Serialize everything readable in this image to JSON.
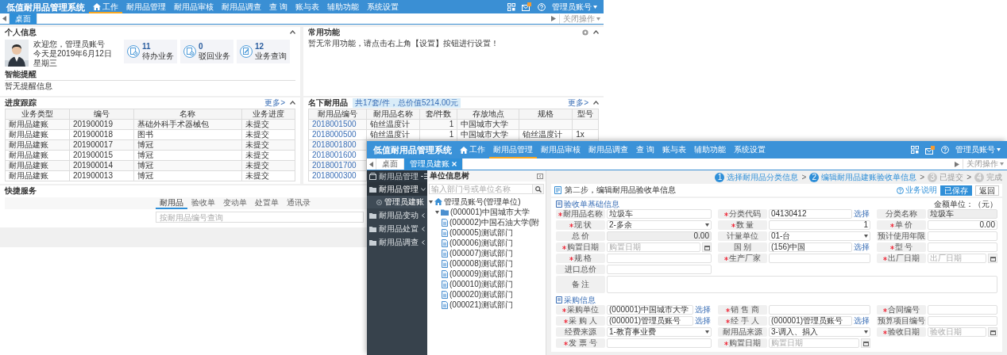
{
  "back_window": {
    "app_title": "低值耐用品管理系统",
    "nav": [
      {
        "label": "工作",
        "selected": true
      },
      {
        "label": "耐用品管理",
        "selected": false
      },
      {
        "label": "耐用品审核",
        "selected": false
      },
      {
        "label": "耐用品调查",
        "selected": false
      },
      {
        "label": "查 询",
        "selected": false
      },
      {
        "label": "账与表",
        "selected": false
      },
      {
        "label": "辅助功能",
        "selected": false
      },
      {
        "label": "系统设置",
        "selected": false
      }
    ],
    "user_menu": "管理员账号",
    "tabs": [
      {
        "label": "桌面",
        "selected": true,
        "closable": false
      }
    ],
    "close_menu": "关闭操作",
    "personal": {
      "title": "个人信息",
      "greeting": "欢迎您，管理员账号",
      "date": "今天是2019年6月12日",
      "weekday": "星期三",
      "stats": [
        {
          "count": "11",
          "label": "待办业务"
        },
        {
          "count": "0",
          "label": "驳回业务"
        },
        {
          "count": "12",
          "label": "业务查询"
        }
      ],
      "reminder_title": "智能提醒",
      "reminder_text": "暂无提醒信息"
    },
    "favorites": {
      "title": "常用功能",
      "text": "暂无常用功能，请点击右上角【设置】按钮进行设置！"
    },
    "progress": {
      "title": "进度跟踪",
      "more": "更多>",
      "columns": [
        "业务类型",
        "编号",
        "名称",
        "业务进度"
      ],
      "rows": [
        [
          "耐用品建账",
          "201900019",
          "基础外科手术器械包",
          "未提交"
        ],
        [
          "耐用品建账",
          "201900018",
          "图书",
          "未提交"
        ],
        [
          "耐用品建账",
          "201900017",
          "博冠",
          "未提交"
        ],
        [
          "耐用品建账",
          "201900015",
          "博冠",
          "未提交"
        ],
        [
          "耐用品建账",
          "201900014",
          "博冠",
          "未提交"
        ],
        [
          "耐用品建账",
          "201900013",
          "博冠",
          "未提交"
        ]
      ]
    },
    "owned": {
      "title": "名下耐用品",
      "summary": "共17套/件，总价值5214.00元",
      "more": "更多>",
      "columns": [
        "耐用品编号",
        "耐用品名称",
        "套/件数",
        "存放地点",
        "规格",
        "型号"
      ],
      "rows": [
        [
          "2018001500",
          "铂丝温度计",
          "1",
          "中国城市大学",
          "",
          ""
        ],
        [
          "2018000500",
          "铂丝温度计",
          "1",
          "中国城市大学",
          "铂丝温度计",
          "1x"
        ],
        [
          "2018001800"
        ],
        [
          "2018001600"
        ],
        [
          "2018001700"
        ],
        [
          "2018000300"
        ]
      ]
    },
    "quick": {
      "title": "快捷服务",
      "tabs": [
        {
          "label": "耐用品",
          "selected": true
        },
        {
          "label": "验收单",
          "selected": false
        },
        {
          "label": "变动单",
          "selected": false
        },
        {
          "label": "处置单",
          "selected": false
        },
        {
          "label": "通讯录",
          "selected": false
        }
      ],
      "search": {
        "placeholder": "按耐用品编号查询"
      }
    }
  },
  "front_window": {
    "app_title": "低值耐用品管理系统",
    "nav": [
      {
        "label": "工作",
        "selected": false
      },
      {
        "label": "耐用品管理",
        "selected": true
      },
      {
        "label": "耐用品审核",
        "selected": false
      },
      {
        "label": "耐用品调查",
        "selected": false
      },
      {
        "label": "查 询",
        "selected": false
      },
      {
        "label": "账与表",
        "selected": false
      },
      {
        "label": "辅助功能",
        "selected": false
      },
      {
        "label": "系统设置",
        "selected": false
      }
    ],
    "user_menu": "管理员账号",
    "tabs": [
      {
        "label": "桌面",
        "selected": false,
        "closable": false
      },
      {
        "label": "管理员建账",
        "selected": true,
        "closable": true
      }
    ],
    "close_menu": "关闭操作",
    "sidebar": {
      "title": "耐用品管理",
      "items": [
        {
          "label": "耐用品管理",
          "expanded": true,
          "children": [
            {
              "label": "管理员建账",
              "selected": true
            }
          ]
        },
        {
          "label": "耐用品变动",
          "expanded": false
        },
        {
          "label": "耐用品处置",
          "expanded": false
        },
        {
          "label": "耐用品调查",
          "expanded": false
        }
      ]
    },
    "unit_tree": {
      "title": "单位信息树",
      "search": {
        "placeholder": "输入部门号或单位名称"
      },
      "nodes": [
        {
          "label": "管理员账号(管理单位)",
          "kind": "root",
          "expanded": true,
          "children": [
            {
              "label": "(000001)中国城市大学",
              "kind": "folder",
              "expanded": true,
              "children": [
                {
                  "label": "(000002)中国石油大学(附",
                  "kind": "leaf"
                },
                {
                  "label": "(000005)测试部门",
                  "kind": "leaf"
                },
                {
                  "label": "(000006)测试部门",
                  "kind": "leaf"
                },
                {
                  "label": "(000007)测试部门",
                  "kind": "leaf"
                },
                {
                  "label": "(000008)测试部门",
                  "kind": "leaf"
                },
                {
                  "label": "(000009)测试部门",
                  "kind": "leaf"
                },
                {
                  "label": "(000010)测试部门",
                  "kind": "leaf"
                },
                {
                  "label": "(000020)测试部门",
                  "kind": "leaf"
                },
                {
                  "label": "(000021)测试部门",
                  "kind": "leaf"
                }
              ]
            }
          ]
        }
      ]
    },
    "steps": [
      {
        "number": "1",
        "label": "选择耐用品分类信息",
        "active": true
      },
      {
        "number": "2",
        "label": "编辑耐用品建账验收单信息",
        "active": true
      },
      {
        "number": "3",
        "label": "已提交",
        "active": false
      },
      {
        "number": "4",
        "label": "完成",
        "active": false
      }
    ],
    "step_separators": [
      ">",
      ">",
      ">"
    ],
    "page_title": "第二步，编辑耐用品验收单信息",
    "actions": [
      {
        "label": "业务说明",
        "kind": "help"
      },
      {
        "label": "已保存",
        "kind": "primary"
      },
      {
        "label": "返回",
        "kind": "default"
      }
    ],
    "sections": [
      {
        "title": "验收单基础信息",
        "note": "金额单位：（元）",
        "rows": [
          [
            {
              "label": "耐用品名称",
              "required": true,
              "kind": "text",
              "value": "垃圾车"
            },
            {
              "label": "分类代码",
              "required": true,
              "kind": "text",
              "value": "04130412",
              "action": "选择"
            },
            {
              "label": "分类名称",
              "required": false,
              "kind": "readonly",
              "value": "垃圾车"
            }
          ],
          [
            {
              "label": "现 状",
              "required": true,
              "kind": "select",
              "value": "2-多余"
            },
            {
              "label": "数 量",
              "required": true,
              "kind": "number",
              "value": "1"
            },
            {
              "label": "单 价",
              "required": true,
              "kind": "number",
              "value": "0.00"
            }
          ],
          [
            {
              "label": "总 价",
              "required": false,
              "kind": "readonly_number",
              "value": "0.00"
            },
            {
              "label": "计量单位",
              "required": false,
              "kind": "select",
              "value": "01-台"
            },
            {
              "label": "预计使用年限",
              "required": false,
              "kind": "text"
            }
          ],
          [
            {
              "label": "购置日期",
              "required": true,
              "kind": "date",
              "placeholder": "购置日期"
            },
            {
              "label": "国 别",
              "required": false,
              "kind": "text",
              "value": "(156)中国",
              "action": "选择"
            },
            {
              "label": "型 号",
              "required": true,
              "kind": "text"
            }
          ],
          [
            {
              "label": "规 格",
              "required": true,
              "kind": "text"
            },
            {
              "label": "生产厂家",
              "required": true,
              "kind": "text"
            },
            {
              "label": "出厂日期",
              "required": true,
              "kind": "date",
              "placeholder": "出厂日期"
            }
          ],
          [
            {
              "label": "进口总价",
              "required": false,
              "kind": "text"
            }
          ],
          [
            {
              "label": "备 注",
              "required": false,
              "kind": "textarea"
            }
          ]
        ]
      },
      {
        "title": "采购信息",
        "rows": [
          [
            {
              "label": "采购单位",
              "required": true,
              "kind": "text",
              "value": "(000001)中国城市大学",
              "action": "选择"
            },
            {
              "label": "销 售 商",
              "required": true,
              "kind": "text"
            },
            {
              "label": "合同编号",
              "required": true,
              "kind": "text"
            }
          ],
          [
            {
              "label": "采 购 人",
              "required": true,
              "kind": "text",
              "value": "(000001)管理员账号",
              "action": "选择"
            },
            {
              "label": "经 手 人",
              "required": true,
              "kind": "text",
              "value": "(000001)管理员账号",
              "action": "选择"
            },
            {
              "label": "预算项目编号",
              "required": false,
              "kind": "text"
            }
          ],
          [
            {
              "label": "经费来源",
              "required": false,
              "kind": "select",
              "value": "1-教育事业费"
            },
            {
              "label": "耐用品来源",
              "required": false,
              "kind": "select",
              "value": "3-调入、捐入"
            },
            {
              "label": "验收日期",
              "required": true,
              "kind": "date",
              "placeholder": "验收日期"
            }
          ],
          [
            {
              "label": "发 票 号",
              "required": true,
              "kind": "text"
            },
            {
              "label": "购置日期",
              "required": true,
              "kind": "date",
              "placeholder": "购置日期"
            }
          ]
        ]
      }
    ]
  }
}
